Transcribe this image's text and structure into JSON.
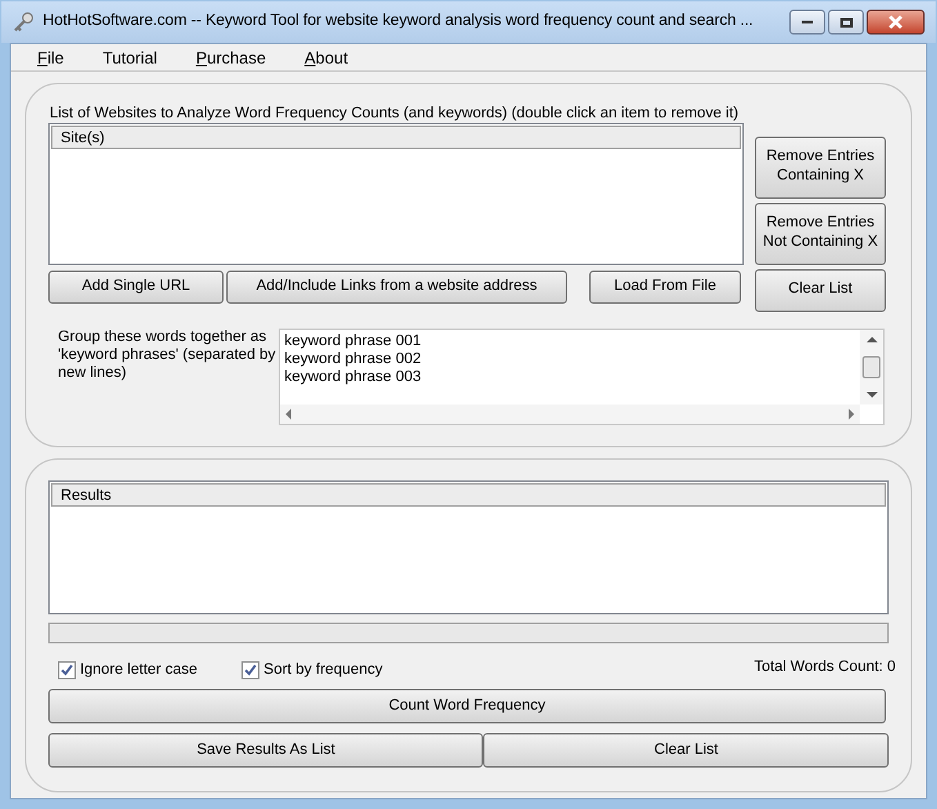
{
  "window": {
    "title": "HotHotSoftware.com -- Keyword Tool for website keyword analysis word frequency count and search ..."
  },
  "menu": [
    {
      "label": "File",
      "mnemonic": true
    },
    {
      "label": "Tutorial",
      "mnemonic": false
    },
    {
      "label": "Purchase",
      "mnemonic": true
    },
    {
      "label": "About",
      "mnemonic": true
    }
  ],
  "sites": {
    "label": "List of Websites to Analyze Word Frequency Counts (and keywords) (double click an item to remove it)",
    "column": "Site(s)",
    "side_buttons": [
      "Remove Entries Containing X",
      "Remove Entries Not Containing X",
      "Clear List"
    ],
    "buttons": [
      "Add Single URL",
      "Add/Include Links from a website address",
      "Load From File"
    ]
  },
  "phrases": {
    "label": "Group these words together as 'keyword phrases' (separated by new lines)",
    "lines": [
      "keyword phrase 001",
      "keyword phrase 002",
      "keyword phrase 003"
    ]
  },
  "results": {
    "column": "Results",
    "level": 0,
    "options": [
      {
        "label": "Ignore letter case",
        "checked": true
      },
      {
        "label": "Sort by frequency",
        "checked": true
      }
    ],
    "total": "Total Words Count: 0",
    "count_button": "Count Word Frequency",
    "buttons": [
      "Save Results As List",
      "Clear List"
    ]
  }
}
